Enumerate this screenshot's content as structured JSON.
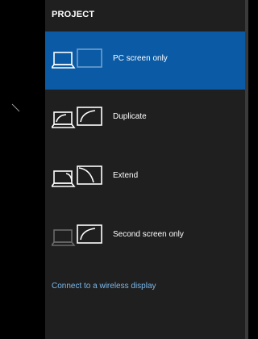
{
  "panel": {
    "title": "PROJECT",
    "options": [
      {
        "label": "PC screen only",
        "icon": "pc-screen-only-icon",
        "selected": true
      },
      {
        "label": "Duplicate",
        "icon": "duplicate-icon",
        "selected": false
      },
      {
        "label": "Extend",
        "icon": "extend-icon",
        "selected": false
      },
      {
        "label": "Second screen only",
        "icon": "second-screen-only-icon",
        "selected": false
      }
    ],
    "wireless_link": "Connect to a wireless display"
  },
  "colors": {
    "panel_background": "#1f1f1f",
    "selected_background": "#0a5aa5",
    "link": "#7cb8ea",
    "text": "#ffffff"
  }
}
